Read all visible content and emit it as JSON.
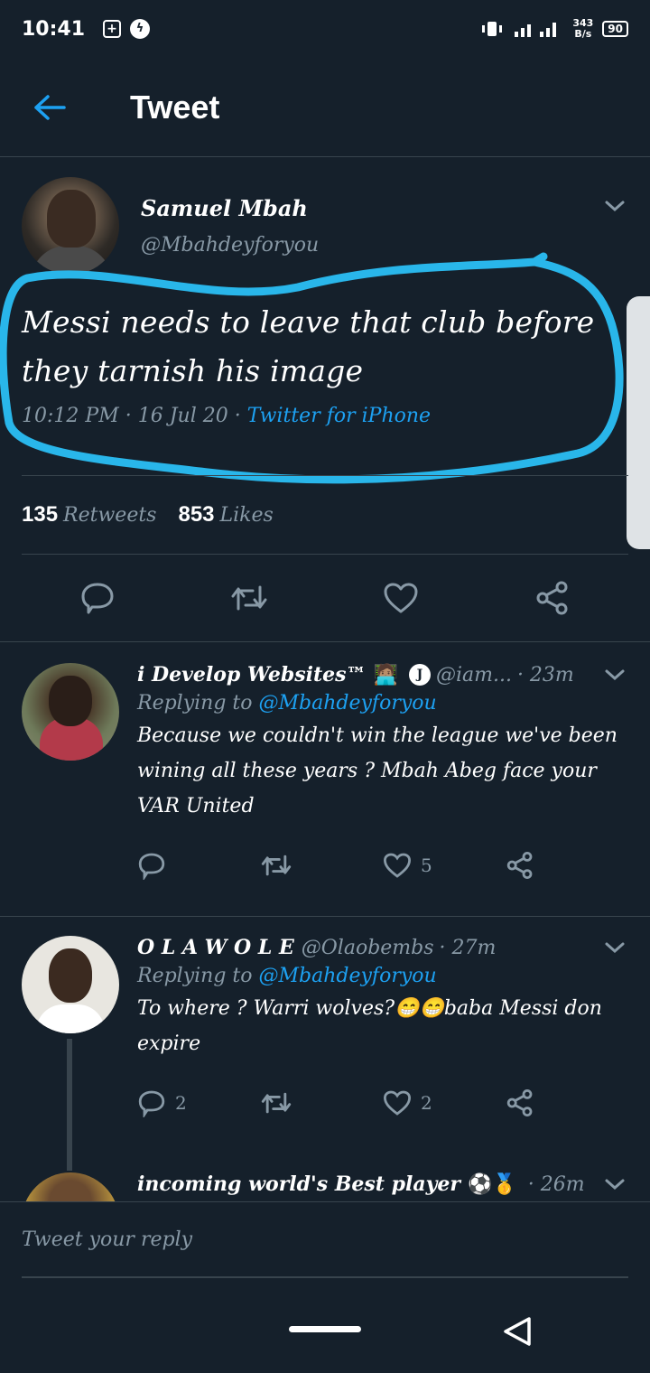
{
  "status_bar": {
    "time": "10:41",
    "net_speed_value": "343",
    "net_speed_unit": "B/s",
    "battery": "90"
  },
  "header": {
    "title": "Tweet"
  },
  "tweet": {
    "display_name": "Samuel Mbah",
    "handle": "@Mbahdeyforyou",
    "text": "Messi needs to leave that club before they tarnish his image",
    "time": "10:12 PM",
    "date": "16 Jul 20",
    "separator": "·",
    "source": "Twitter for iPhone",
    "retweets_count": "135",
    "retweets_label": "Retweets",
    "likes_count": "853",
    "likes_label": "Likes"
  },
  "replies": [
    {
      "display_name": "i Develop Websites™",
      "emoji": "🧑🏽‍💻",
      "badge": "J",
      "handle": "@iam...",
      "time": "· 23m",
      "replying_label": "Replying to",
      "replying_to": "@Mbahdeyforyou",
      "text": "Because we couldn't win the league we've been wining all these years ? Mbah Abeg face your VAR United",
      "reply_count": "",
      "retweet_count": "",
      "like_count": "5"
    },
    {
      "display_name": "O L A W O L E",
      "handle": "@Olaobembs",
      "time": "· 27m",
      "replying_label": "Replying to",
      "replying_to": "@Mbahdeyforyou",
      "text": "To where ? Warri wolves?😁😁baba Messi don expire",
      "reply_count": "2",
      "retweet_count": "",
      "like_count": "2"
    },
    {
      "display_name": "incoming world's Best player",
      "emoji": "⚽🥇",
      "time": "· 26m"
    }
  ],
  "reply_bar": {
    "placeholder": "Tweet your reply"
  },
  "colors": {
    "background": "#15202b",
    "accent": "#1da1f2",
    "muted": "#8899a6",
    "divider": "#38444d",
    "highlight": "#29b6ea"
  }
}
